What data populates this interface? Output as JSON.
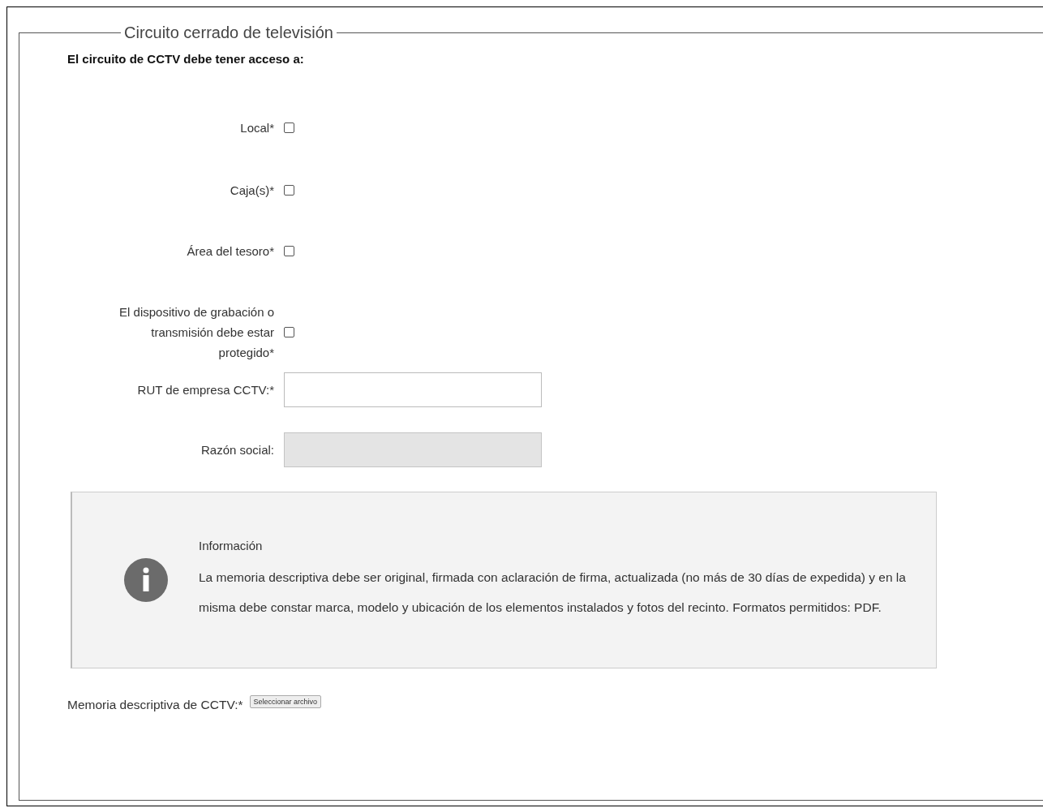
{
  "fieldset": {
    "legend": "Circuito cerrado de televisión"
  },
  "heading": "El circuito de CCTV debe tener acceso a:",
  "checkboxes": [
    {
      "label": "Local*",
      "checked": false
    },
    {
      "label": "Caja(s)*",
      "checked": false
    },
    {
      "label": "Área del tesoro*",
      "checked": false
    },
    {
      "label": "El dispositivo de grabación o transmisión debe estar protegido*",
      "checked": false
    }
  ],
  "fields": [
    {
      "label": "RUT de empresa CCTV:*",
      "disabled": false
    },
    {
      "label": "Razón social:",
      "disabled": true
    }
  ],
  "info": {
    "title": "Información",
    "text": "La memoria descriptiva debe ser original, firmada con aclaración de firma, actualizada (no más de 30 días de expedida) y en la misma debe constar marca, modelo y ubicación de los elementos instalados y fotos del recinto. Formatos permitidos: PDF."
  },
  "file_upload": {
    "label": "Memoria descriptiva de CCTV:*",
    "button": "Seleccionar archivo"
  }
}
